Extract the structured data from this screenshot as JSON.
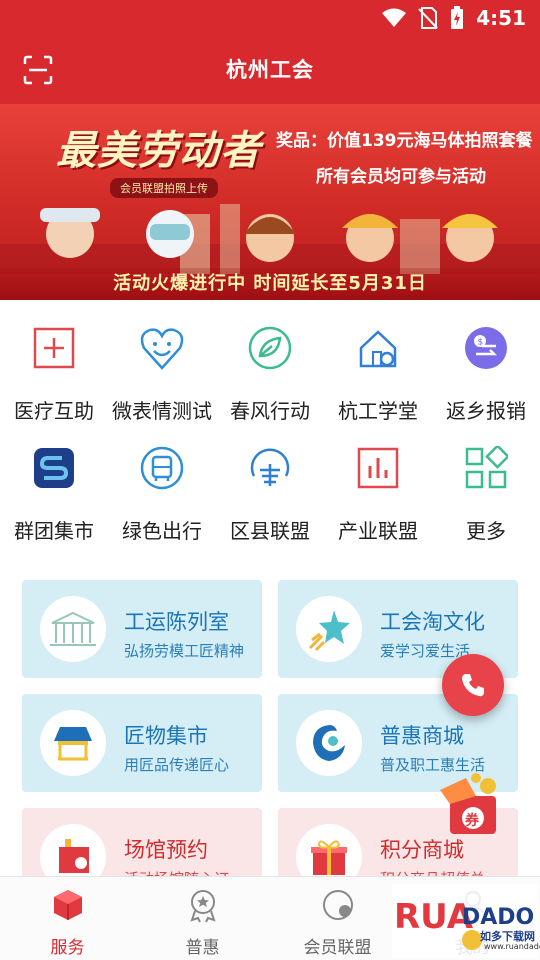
{
  "status_bar": {
    "time": "4:51"
  },
  "header": {
    "title": "杭州工会"
  },
  "banner": {
    "title": "最美劳动者",
    "tag": "会员联盟拍照上传",
    "prize": "奖品：价值139元海马体拍照套餐",
    "participants": "所有会员均可参与活动",
    "slogan": "活动火爆进行中 时间延长至5月31日"
  },
  "services": [
    {
      "label": "医疗互助",
      "icon": "medical-cross-icon"
    },
    {
      "label": "微表情测试",
      "icon": "smile-heart-icon"
    },
    {
      "label": "春风行动",
      "icon": "leaf-icon"
    },
    {
      "label": "杭工学堂",
      "icon": "house-icon"
    },
    {
      "label": "返乡报销",
      "icon": "reimburse-icon"
    },
    {
      "label": "群团集市",
      "icon": "market-s-icon"
    },
    {
      "label": "绿色出行",
      "icon": "bus-icon"
    },
    {
      "label": "区县联盟",
      "icon": "alliance-icon"
    },
    {
      "label": "产业联盟",
      "icon": "bar-chart-icon"
    },
    {
      "label": "更多",
      "icon": "grid-more-icon"
    }
  ],
  "cards": [
    {
      "title": "工运陈列室",
      "subtitle": "弘扬劳模工匠精神",
      "icon": "museum-icon"
    },
    {
      "title": "工会淘文化",
      "subtitle": "爱学习爱生活",
      "icon": "star-icon"
    },
    {
      "title": "匠物集市",
      "subtitle": "用匠品传递匠心",
      "icon": "stall-icon"
    },
    {
      "title": "普惠商城",
      "subtitle": "普及职工惠生活",
      "icon": "mall-icon"
    },
    {
      "title": "场馆预约",
      "subtitle": "活动场馆随心订",
      "icon": "venue-icon"
    },
    {
      "title": "积分商城",
      "subtitle": "积分商品超值兑",
      "icon": "gift-icon"
    }
  ],
  "coupon": {
    "label": "券"
  },
  "tabs": [
    {
      "label": "服务",
      "active": true
    },
    {
      "label": "普惠",
      "active": false
    },
    {
      "label": "会员联盟",
      "active": false
    },
    {
      "label": "我的",
      "active": false
    }
  ],
  "watermark": {
    "brand": "RUANDADO",
    "cn": "如多下载网",
    "url": "www.ruandado.com"
  },
  "colors": {
    "primary": "#d8292f",
    "card_blue": "#d5eef6",
    "card_pink": "#fbe6e7",
    "link_blue": "#1a75b8"
  }
}
